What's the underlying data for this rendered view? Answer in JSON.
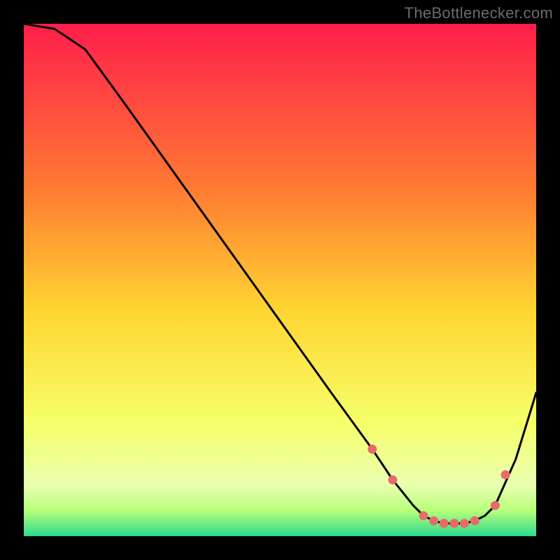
{
  "watermark": "TheBottlenecker.com",
  "colors": {
    "top": "#ff1e4b",
    "mid_upper": "#ff7a33",
    "mid": "#ffd531",
    "mid_lower": "#f6ff6a",
    "near_bottom": "#b7ff7a",
    "bottom": "#2bd98e",
    "curve": "#000000",
    "marker": "#e96a6a",
    "frame": "#000000"
  },
  "chart_data": {
    "type": "line",
    "title": "",
    "xlabel": "",
    "ylabel": "",
    "ylim": [
      0,
      100
    ],
    "xlim": [
      0,
      100
    ],
    "x": [
      0,
      6,
      12,
      20,
      30,
      40,
      50,
      60,
      68,
      72,
      76,
      78,
      80,
      82,
      84,
      86,
      88,
      90,
      92,
      96,
      100
    ],
    "values": [
      100,
      99,
      95,
      84,
      70,
      56,
      42,
      28,
      17,
      11,
      6,
      4,
      3,
      2.5,
      2.5,
      2.5,
      3,
      4,
      6,
      15,
      28
    ],
    "markers_x": [
      68,
      72,
      78,
      80,
      82,
      84,
      86,
      88,
      92,
      94
    ],
    "markers_y": [
      17,
      11,
      4,
      3,
      2.5,
      2.5,
      2.5,
      3,
      6,
      12
    ]
  }
}
